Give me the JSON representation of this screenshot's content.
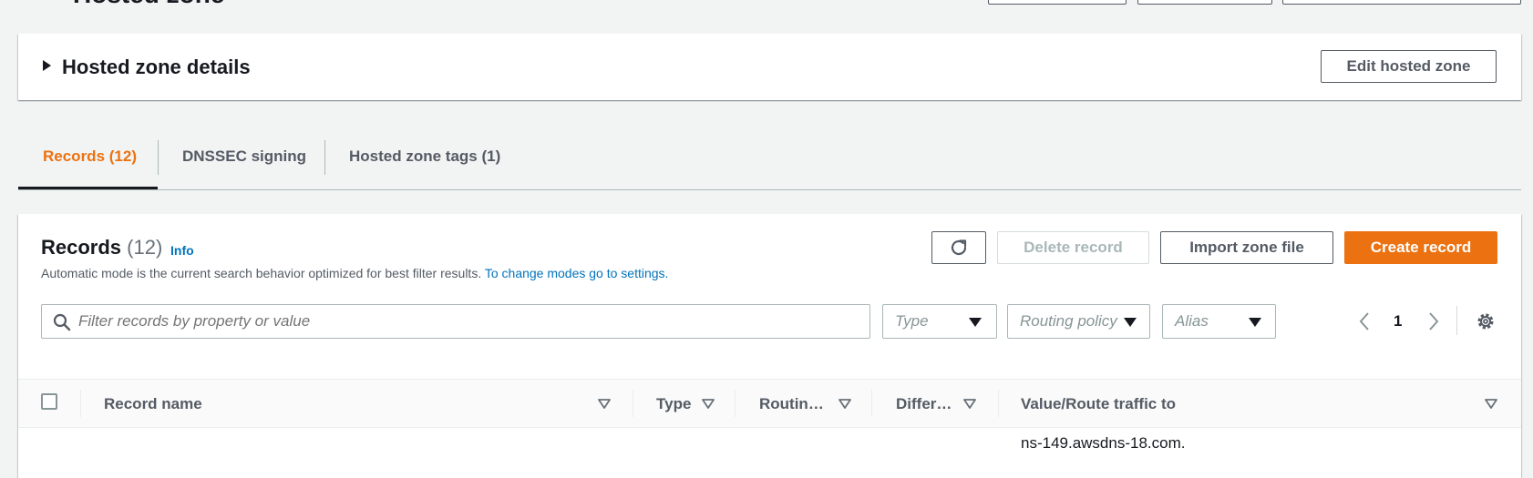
{
  "hero": {
    "title": "Hosted zone"
  },
  "details_panel": {
    "title": "Hosted zone details",
    "edit_button": "Edit hosted zone"
  },
  "tabs": [
    {
      "label": "Records (12)",
      "active": true
    },
    {
      "label": "DNSSEC signing",
      "active": false
    },
    {
      "label": "Hosted zone tags (1)",
      "active": false
    }
  ],
  "records": {
    "title": "Records",
    "count": "(12)",
    "info_link": "Info",
    "description": "Automatic mode is the current search behavior optimized for best filter results.",
    "settings_link": "To change modes go to settings.",
    "buttons": {
      "delete": "Delete record",
      "import": "Import zone file",
      "create": "Create record"
    },
    "filter": {
      "placeholder": "Filter records by property or value"
    },
    "selects": {
      "type": "Type",
      "routing": "Routing policy",
      "alias": "Alias"
    },
    "pagination": {
      "page": "1"
    },
    "columns": {
      "record_name": "Record name",
      "type": "Type",
      "routing": "Routin…",
      "differ": "Differ…",
      "value": "Value/Route traffic to"
    },
    "rows": [
      {
        "value_line1": "ns-149.awsdns-18.com."
      }
    ]
  },
  "colors": {
    "accent": "#ec7211",
    "link": "#0073bb",
    "text": "#16191f",
    "muted": "#545b64"
  }
}
